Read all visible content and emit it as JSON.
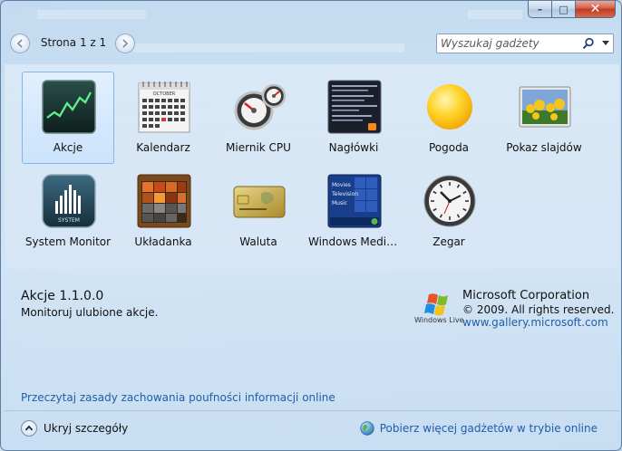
{
  "window": {
    "caption": {
      "minimize": "–",
      "maximize": "□",
      "close": "✕"
    }
  },
  "toolbar": {
    "page_indicator": "Strona 1 z 1",
    "search_placeholder": "Wyszukaj gadżety"
  },
  "gadgets": [
    {
      "id": "akcje",
      "label": "Akcje",
      "selected": true
    },
    {
      "id": "kalendarz",
      "label": "Kalendarz",
      "selected": false
    },
    {
      "id": "miernik-cpu",
      "label": "Miernik CPU",
      "selected": false
    },
    {
      "id": "naglowki",
      "label": "Nagłówki",
      "selected": false
    },
    {
      "id": "pogoda",
      "label": "Pogoda",
      "selected": false
    },
    {
      "id": "pokaz-slajdow",
      "label": "Pokaz slajdów",
      "selected": false
    },
    {
      "id": "system-monitor",
      "label": "System Monitor",
      "selected": false
    },
    {
      "id": "ukladanka",
      "label": "Układanka",
      "selected": false
    },
    {
      "id": "waluta",
      "label": "Waluta",
      "selected": false
    },
    {
      "id": "windows-media",
      "label": "Windows Media...",
      "selected": false
    },
    {
      "id": "zegar",
      "label": "Zegar",
      "selected": false
    }
  ],
  "thumbs": {
    "calendar_month": "OCTOBER",
    "system_text": "SYSTEM",
    "media_lines": [
      "Movies",
      "Television",
      "Music"
    ]
  },
  "details": {
    "title": "Akcje 1.1.0.0",
    "description": "Monitoruj ulubione akcje."
  },
  "publisher": {
    "logo_text": "Windows Live",
    "name": "Microsoft Corporation",
    "copyright": "© 2009. All rights reserved.",
    "url": "www.gallery.microsoft.com"
  },
  "links": {
    "privacy": "Przeczytaj zasady zachowania poufności informacji online",
    "hide_details": "Ukryj szczegóły",
    "get_more": "Pobierz więcej gadżetów w trybie online"
  },
  "colors": {
    "link": "#1f5ea8",
    "selection_border": "#84b5e6",
    "close_button": "#c2381e"
  }
}
